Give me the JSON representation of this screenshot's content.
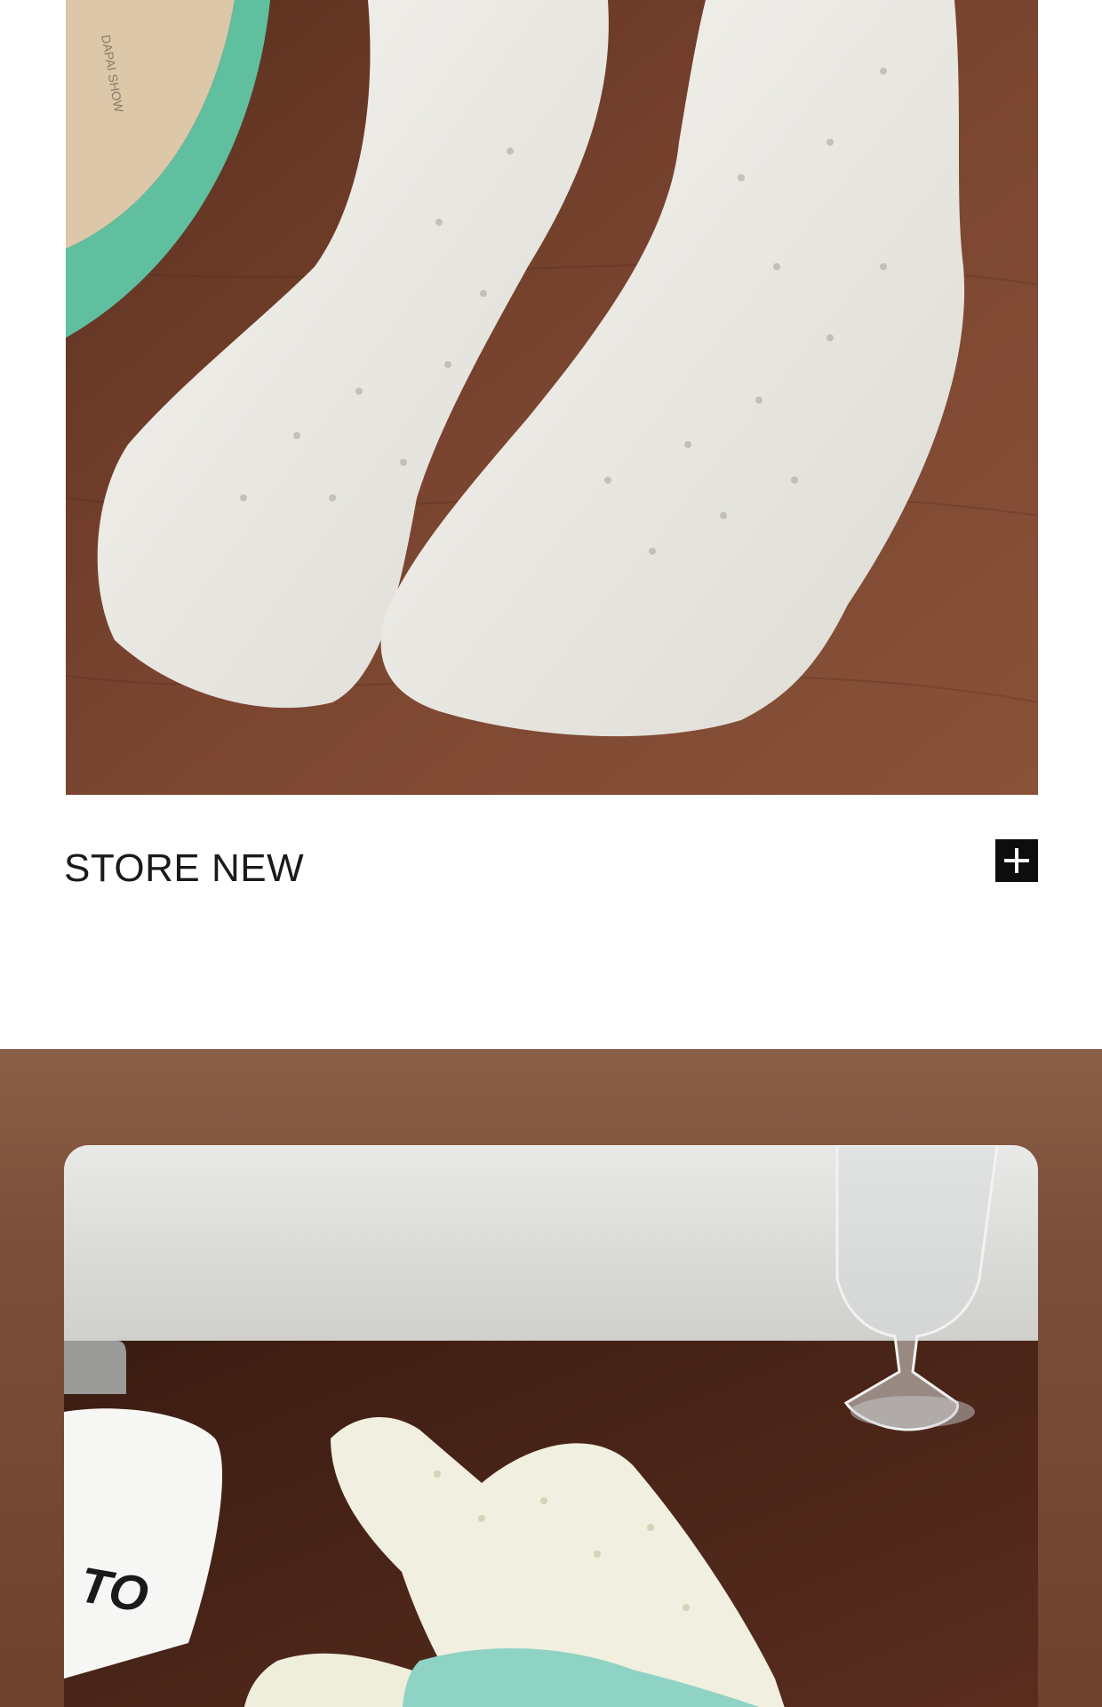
{
  "section": {
    "title": "STORE NEW"
  },
  "icons": {
    "expand": "plus-icon"
  },
  "colors": {
    "text": "#1a1a1a",
    "icon_bg": "#0d0d0d",
    "wood": "#6b3a25",
    "sock": "#eeece6",
    "mint": "#5fbf9f"
  },
  "photo_top": {
    "shoebox_text": "DAPAI SHOW"
  },
  "photo_bottom": {
    "sock_print": "TO"
  }
}
